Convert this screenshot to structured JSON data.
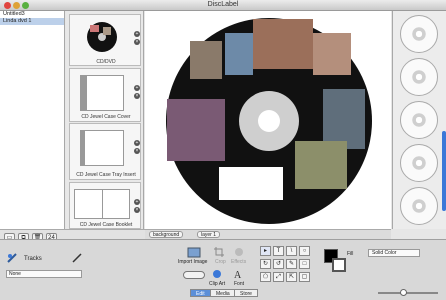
{
  "window": {
    "title": "DiscLabel"
  },
  "documents": [
    {
      "label": "Untitled3",
      "selected": false
    },
    {
      "label": "Linda dvd 1",
      "selected": true
    }
  ],
  "templates": [
    {
      "label": "CD/DVD"
    },
    {
      "label": "CD Jewel Case Cover"
    },
    {
      "label": "CD Jewel Case Tray Insert"
    },
    {
      "label": "CD Jewel Case Booklet"
    }
  ],
  "layers": {
    "background": "background",
    "layer1": "layer 1"
  },
  "toolbar": {
    "tracks": "Tracks",
    "tracks_select": "None",
    "import_image": "Import Image",
    "crop": "Crop",
    "effects": "Effects",
    "clip_art": "Clip Art",
    "font": "Font",
    "fill": "Fill",
    "fill_mode": "Solid Color"
  },
  "view_tabs": [
    "Edit",
    "Media",
    "Store"
  ],
  "colors": {
    "accent": "#3b78d8",
    "disc": "#111111"
  }
}
